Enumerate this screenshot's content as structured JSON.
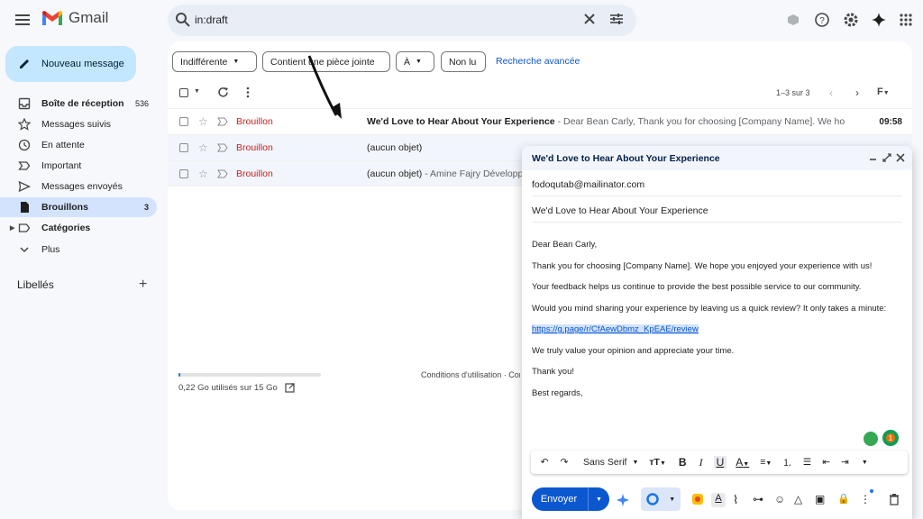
{
  "app": {
    "name": "Gmail"
  },
  "search": {
    "value": "in:draft"
  },
  "compose_button": {
    "label": "Nouveau message"
  },
  "sidebar": {
    "items": [
      {
        "label": "Boîte de réception",
        "count": "536",
        "icon": "inbox-icon"
      },
      {
        "label": "Messages suivis",
        "count": "",
        "icon": "star-icon"
      },
      {
        "label": "En attente",
        "count": "",
        "icon": "clock-icon"
      },
      {
        "label": "Important",
        "count": "",
        "icon": "important-icon"
      },
      {
        "label": "Messages envoyés",
        "count": "",
        "icon": "send-icon"
      },
      {
        "label": "Brouillons",
        "count": "3",
        "icon": "draft-icon"
      },
      {
        "label": "Catégories",
        "count": "",
        "icon": "label-icon"
      },
      {
        "label": "Plus",
        "count": "",
        "icon": "chevron-down-icon"
      }
    ],
    "labels_title": "Libellés"
  },
  "filters": {
    "chips": [
      "Indifférente",
      "Contient une pièce jointe",
      "À",
      "Non lu"
    ],
    "advanced": "Recherche avancée"
  },
  "list": {
    "pagination": "1–3 sur 3",
    "rows": [
      {
        "sender": "Brouillon",
        "subject": "We'd Love to Hear About Your Experience",
        "snippet": " - Dear Bean Carly, Thank you for choosing [Company Name]. We ho...",
        "time": "09:58"
      },
      {
        "sender": "Brouillon",
        "subject": "(aucun objet)",
        "snippet": "",
        "time": ""
      },
      {
        "sender": "Brouillon",
        "subject": "(aucun objet)",
        "snippet": " - Amine Fajry Développ",
        "time": ""
      }
    ]
  },
  "footer": {
    "storage": "0,22 Go utilisés sur 15 Go",
    "storage_fraction": 0.015,
    "terms": "Conditions d'utilisation · Con"
  },
  "compose": {
    "title": "We'd Love to Hear About Your Experience",
    "to": "fodoqutab@mailinator.com",
    "subject": "We'd Love to Hear About Your Experience",
    "body": [
      "Dear Bean Carly,",
      "Thank you for choosing [Company Name]. We hope you enjoyed your experience with us!",
      "Your feedback helps us continue to provide the best possible service to our community.",
      "Would you mind sharing your experience by leaving us a quick review? It only takes a minute:",
      "https://g.page/r/CfAewDbmz_KpEAE/review",
      "We truly value your opinion and appreciate your time.",
      "Thank you!",
      "Best regards,"
    ],
    "font": "Sans Serif",
    "send_label": "Envoyer",
    "badge_count": "1"
  },
  "colors": {
    "accent": "#0b57d0",
    "draft_red": "#c5221f",
    "active_nav": "#d3e3fd",
    "compose_btn": "#c2e7ff"
  }
}
